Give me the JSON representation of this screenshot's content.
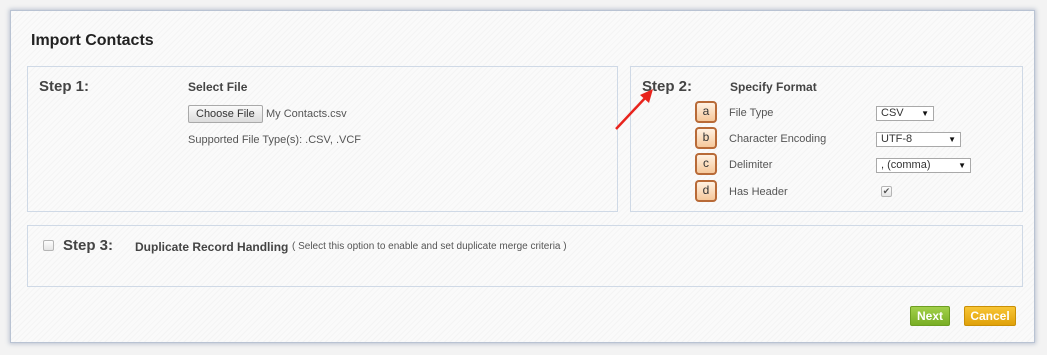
{
  "dialog": {
    "title": "Import Contacts"
  },
  "step1": {
    "label": "Step 1:",
    "heading": "Select File",
    "choose_button": "Choose File",
    "file_name": "My Contacts.csv",
    "supported_types": "Supported File Type(s): .CSV, .VCF"
  },
  "step2": {
    "label": "Step 2:",
    "heading": "Specify Format",
    "rows": [
      {
        "badge": "a",
        "label": "File Type",
        "value": "CSV"
      },
      {
        "badge": "b",
        "label": "Character Encoding",
        "value": "UTF-8"
      },
      {
        "badge": "c",
        "label": "Delimiter",
        "value": ", (comma)"
      },
      {
        "badge": "d",
        "label": "Has Header",
        "checked": true
      }
    ]
  },
  "step3": {
    "label": "Step 3:",
    "heading": "Duplicate Record Handling",
    "hint": "( Select this option to enable and set duplicate merge criteria )",
    "checked": false
  },
  "buttons": {
    "next": "Next",
    "cancel": "Cancel"
  },
  "icons": {
    "checkmark": "✔",
    "dropdown": "▼"
  },
  "colors": {
    "next": "#8cc03a",
    "cancel": "#f0b21d",
    "annotation_arrow": "#e8231c",
    "badge": "#f6c89b"
  }
}
